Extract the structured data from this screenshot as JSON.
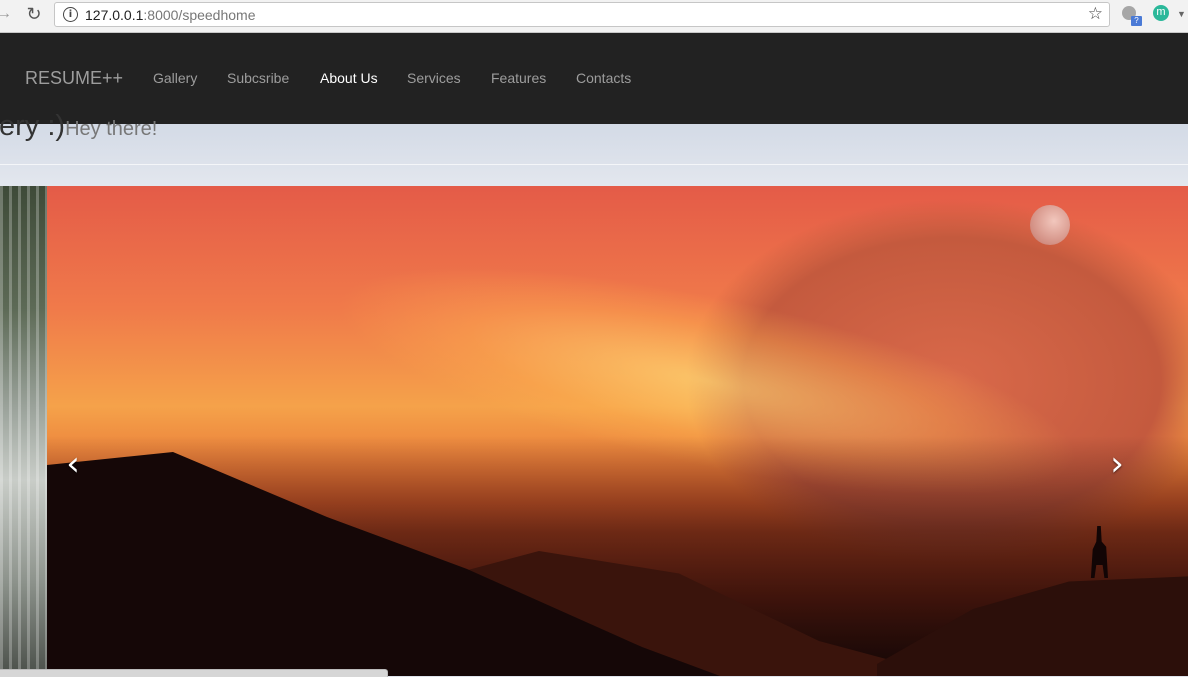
{
  "browser": {
    "url_host": "127.0.0.1",
    "url_path": ":8000/speedhome",
    "icons": [
      "back-icon",
      "reload-icon",
      "info-icon",
      "star-icon",
      "extension-icon",
      "m-extension-icon"
    ],
    "extension_badge": "?",
    "extension_m_label": "m"
  },
  "navbar": {
    "brand": "RESUME++",
    "links": [
      {
        "label": "Gallery",
        "active": false
      },
      {
        "label": "Subcsribe",
        "active": false
      },
      {
        "label": "About Us",
        "active": true
      },
      {
        "label": "Services",
        "active": false
      },
      {
        "label": "Features",
        "active": false
      },
      {
        "label": "Contacts",
        "active": false
      }
    ]
  },
  "header": {
    "title": "allery :)",
    "subtitle": "Hey there!"
  },
  "carousel": {
    "prev_glyph": "‹",
    "next_glyph": "›"
  },
  "colors": {
    "navbar_bg": "#222222",
    "nav_link": "#9d9d9d",
    "nav_active": "#ffffff"
  }
}
